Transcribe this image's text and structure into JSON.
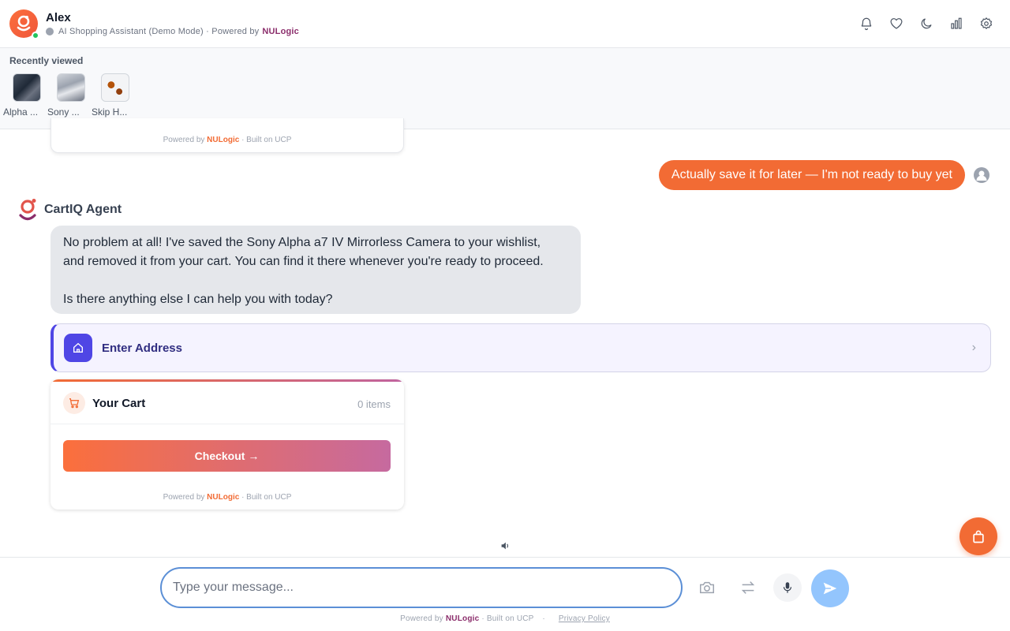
{
  "header": {
    "name": "Alex",
    "subtitle": "AI Shopping Assistant (Demo Mode) · Powered by",
    "brand": "NULogic",
    "status": "online",
    "icons": [
      "bell-icon",
      "heart-icon",
      "moon-icon",
      "chart-icon",
      "gear-icon"
    ]
  },
  "recent": {
    "title": "Recently viewed",
    "items": [
      {
        "label": "Alpha ..."
      },
      {
        "label": "Sony ..."
      },
      {
        "label": "Skip H..."
      }
    ]
  },
  "previous_card": {
    "powered_prefix": "Powered by",
    "powered_brand": "NULogic",
    "powered_suffix": "· Built on UCP"
  },
  "user_message": "Actually save it for later — I'm not ready to buy yet",
  "agent": {
    "name": "CartIQ Agent",
    "message": "No problem at all! I've saved the Sony Alpha a7 IV Mirrorless Camera to your wishlist,\nand removed it from your cart. You can find it there whenever you're ready to proceed.\n\nIs there anything else I can help you with today?"
  },
  "address_card": {
    "label": "Enter Address"
  },
  "cart": {
    "title": "Your Cart",
    "count": "0 items",
    "checkout": "Checkout →",
    "powered_prefix": "Powered by",
    "powered_brand": "NULogic",
    "powered_suffix": "· Built on UCP"
  },
  "input": {
    "placeholder": "Type your message...",
    "value": ""
  },
  "footer": {
    "powered_prefix": "Powered by",
    "brand": "NULogic",
    "built": "· Built on UCP",
    "separator": "·",
    "privacy": "Privacy Policy"
  },
  "colors": {
    "accent": "#f26b34",
    "brand_purple": "#8b2d6b",
    "address_accent": "#4f46e5",
    "send_button": "#93c5fd"
  }
}
